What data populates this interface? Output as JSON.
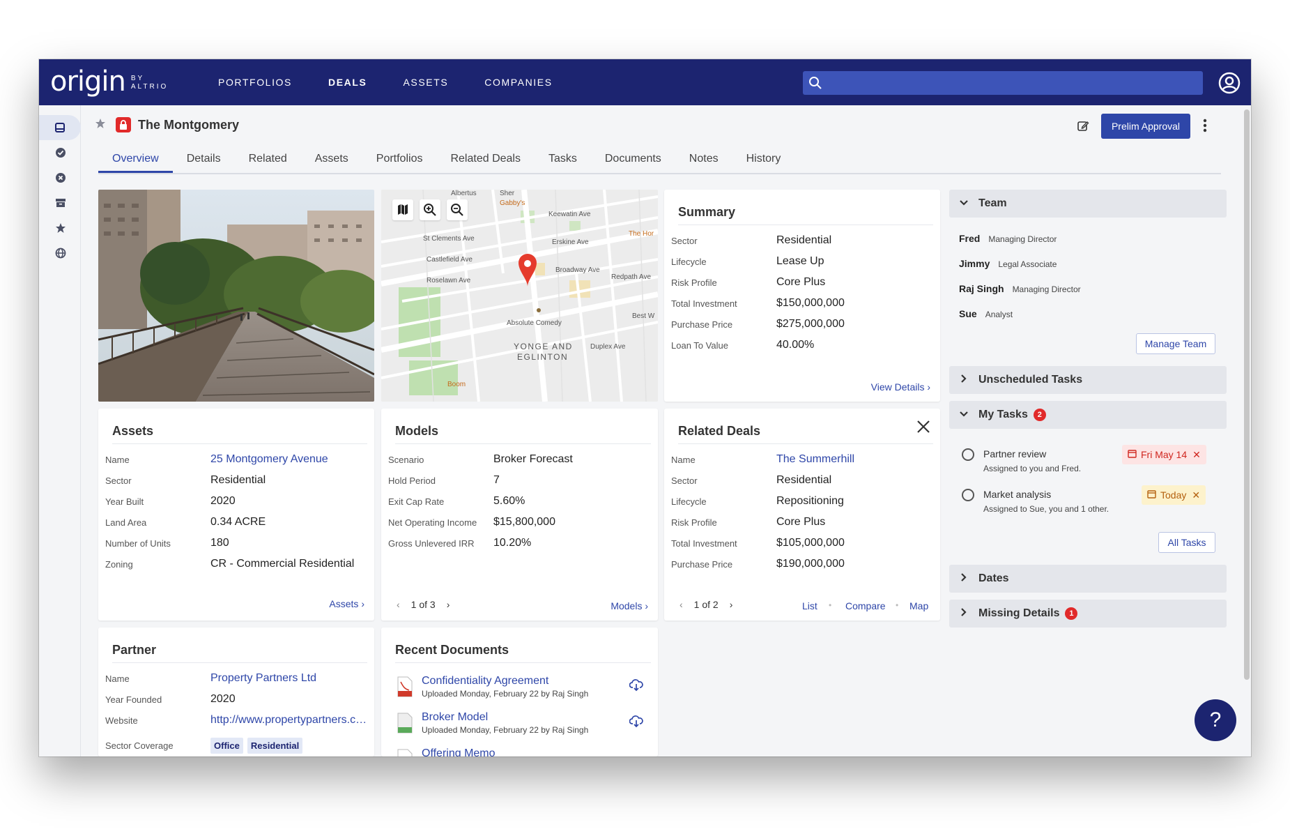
{
  "app": {
    "logo": "origin",
    "logo_sub": "BY ALTRIO",
    "nav": [
      {
        "label": "PORTFOLIOS",
        "active": false
      },
      {
        "label": "DEALS",
        "active": true
      },
      {
        "label": "ASSETS",
        "active": false
      },
      {
        "label": "COMPANIES",
        "active": false
      }
    ],
    "search_placeholder": ""
  },
  "sidebar": {
    "items": [
      "inbox-icon",
      "check-circle-icon",
      "x-circle-icon",
      "archive-icon",
      "star-icon",
      "globe-icon"
    ]
  },
  "header": {
    "title": "The Montgomery",
    "primary_button": "Prelim Approval"
  },
  "tabs": [
    "Overview",
    "Details",
    "Related",
    "Assets",
    "Portfolios",
    "Related Deals",
    "Tasks",
    "Documents",
    "Notes",
    "History"
  ],
  "summary": {
    "title": "Summary",
    "rows": [
      {
        "key": "Sector",
        "value": "Residential"
      },
      {
        "key": "Lifecycle",
        "value": "Lease Up"
      },
      {
        "key": "Risk Profile",
        "value": "Core Plus"
      },
      {
        "key": "Total Investment",
        "value": "$150,000,000"
      },
      {
        "key": "Purchase Price",
        "value": "$275,000,000"
      },
      {
        "key": "Loan To Value",
        "value": "40.00%"
      }
    ],
    "link": "View Details ›"
  },
  "map": {
    "labels": {
      "albertus": "Albertus",
      "gabbys": "Gabby's",
      "keewatin": "Keewatin Ave",
      "stclements": "St Clements Ave",
      "erskine": "Erskine Ave",
      "castlefield": "Castlefield Ave",
      "thehor": "The Hor",
      "broadway": "Broadway Ave",
      "roselawn": "Roselawn Ave",
      "redpath": "Redpath Ave",
      "bestw": "Best W",
      "absolute": "Absolute Comedy",
      "yonge": "YONGE AND",
      "eglinton": "EGLINTON",
      "duplex": "Duplex Ave",
      "boom": "Boom",
      "sher": "Sher"
    }
  },
  "assets": {
    "title": "Assets",
    "rows": [
      {
        "key": "Name",
        "value": "25 Montgomery Avenue",
        "link": true
      },
      {
        "key": "Sector",
        "value": "Residential"
      },
      {
        "key": "Year Built",
        "value": "2020"
      },
      {
        "key": "Land Area",
        "value": "0.34 ACRE"
      },
      {
        "key": "Number of Units",
        "value": "180"
      },
      {
        "key": "Zoning",
        "value": "CR - Commercial Residential"
      }
    ],
    "link": "Assets ›"
  },
  "models": {
    "title": "Models",
    "rows": [
      {
        "key": "Scenario",
        "value": "Broker Forecast"
      },
      {
        "key": "Hold Period",
        "value": "7"
      },
      {
        "key": "Exit Cap Rate",
        "value": "5.60%"
      },
      {
        "key": "Net Operating Income",
        "value": "$15,800,000"
      },
      {
        "key": "Gross Unlevered IRR",
        "value": "10.20%"
      }
    ],
    "pager": "1 of 3",
    "link": "Models ›"
  },
  "related_deals": {
    "title": "Related Deals",
    "rows": [
      {
        "key": "Name",
        "value": "The Summerhill",
        "link": true
      },
      {
        "key": "Sector",
        "value": "Residential"
      },
      {
        "key": "Lifecycle",
        "value": "Repositioning"
      },
      {
        "key": "Risk Profile",
        "value": "Core Plus"
      },
      {
        "key": "Total Investment",
        "value": "$105,000,000"
      },
      {
        "key": "Purchase Price",
        "value": "$190,000,000"
      }
    ],
    "pager": "1 of 2",
    "links": {
      "list": "List",
      "compare": "Compare",
      "map": "Map"
    }
  },
  "partner": {
    "title": "Partner",
    "rows": [
      {
        "key": "Name",
        "value": "Property Partners Ltd",
        "link": true
      },
      {
        "key": "Year Founded",
        "value": "2020"
      },
      {
        "key": "Website",
        "value": "http://www.propertypartners.com",
        "link": true
      }
    ],
    "sector_label": "Sector Coverage",
    "chips": [
      "Office",
      "Residential"
    ]
  },
  "documents": {
    "title": "Recent Documents",
    "items": [
      {
        "title": "Confidentiality Agreement",
        "sub": "Uploaded Monday, February 22 by Raj Singh",
        "type": "PDF"
      },
      {
        "title": "Broker Model",
        "sub": "Uploaded Monday, February 22 by Raj Singh",
        "type": "XLS"
      },
      {
        "title": "Offering Memo",
        "sub": "",
        "type": "PDF"
      }
    ]
  },
  "team": {
    "title": "Team",
    "members": [
      {
        "name": "Fred",
        "role": "Managing Director"
      },
      {
        "name": "Jimmy",
        "role": "Legal Associate"
      },
      {
        "name": "Raj Singh",
        "role": "Managing Director"
      },
      {
        "name": "Sue",
        "role": "Analyst"
      }
    ],
    "button": "Manage Team"
  },
  "unscheduled": {
    "title": "Unscheduled Tasks"
  },
  "my_tasks": {
    "title": "My Tasks",
    "count": "2",
    "items": [
      {
        "title": "Partner review",
        "sub": "Assigned to you and Fred.",
        "due": "Fri May 14"
      },
      {
        "title": "Market analysis",
        "sub": "Assigned to Sue, you and 1 other.",
        "due": "Today"
      }
    ],
    "button": "All Tasks"
  },
  "dates": {
    "title": "Dates"
  },
  "missing": {
    "title": "Missing Details",
    "count": "1"
  },
  "help": "?",
  "colors": {
    "navy": "#1c2470",
    "primary": "#2e46a8",
    "danger": "#e12a2a"
  }
}
